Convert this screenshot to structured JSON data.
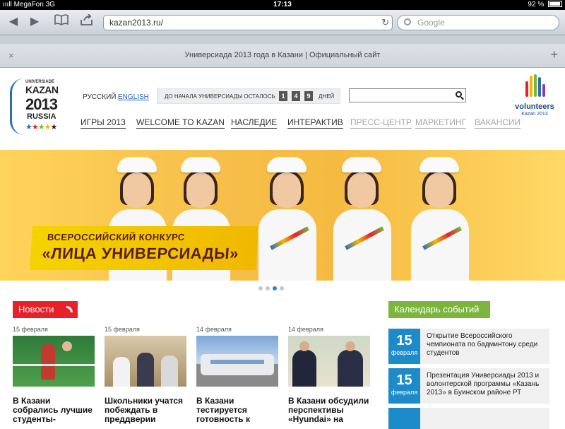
{
  "status_bar": {
    "carrier": "MegaFon",
    "network": "3G",
    "time": "17:13",
    "battery": "92 %"
  },
  "browser": {
    "url": "kazan2013.ru/",
    "search_placeholder": "Google",
    "tab_title": "Универсиада 2013 года в Казани | Официальный сайт",
    "close_tab": "×",
    "new_tab": "+"
  },
  "site": {
    "logo": {
      "universiade": "UNIVERSIADE",
      "city": "KAZAN",
      "year": "2013",
      "country": "RUSSIA",
      "stars": "★★★★★"
    },
    "lang": {
      "ru": "РУССКИЙ",
      "en": "ENGLISH"
    },
    "countdown": {
      "label": "ДО НАЧАЛА УНИВЕРСИАДЫ ОСТАЛОСЬ",
      "digits": [
        "1",
        "4",
        "9"
      ],
      "unit": "ДНЕЙ"
    },
    "volunteers": {
      "title": "volunteers",
      "subtitle": "Kazan 2013"
    },
    "nav": [
      {
        "label": "ИГРЫ 2013",
        "active": true
      },
      {
        "label": "WELCOME TO KAZAN",
        "active": true
      },
      {
        "label": "НАСЛЕДИЕ",
        "active": true
      },
      {
        "label": "ИНТЕРАКТИВ",
        "active": true
      },
      {
        "label": "ПРЕСС-ЦЕНТР",
        "active": false
      },
      {
        "label": "МАРКЕТИНГ",
        "active": false
      },
      {
        "label": "ВАКАНСИИ",
        "active": false
      }
    ],
    "banner": {
      "line1": "ВСЕРОССИЙСКИЙ КОНКУРС",
      "line2": "«ЛИЦА УНИВЕРСИАДЫ»"
    },
    "slider": {
      "count": 4,
      "active": 3
    },
    "news": {
      "heading": "Новости",
      "items": [
        {
          "date": "15 февраля",
          "title": "В Казани собрались лучшие студенты-"
        },
        {
          "date": "15 февраля",
          "title": "Школьники учатся побеждать в преддверии"
        },
        {
          "date": "14 февраля",
          "title": "В Казани тестируется готовность к"
        },
        {
          "date": "14 февраля",
          "title": "В Казани обсудили перспективы «Hyundai» на"
        }
      ]
    },
    "calendar": {
      "heading": "Календарь событий",
      "events": [
        {
          "day": "15",
          "month": "февраля",
          "text": "Открытие Всероссийского чемпионата по бадминтону среди студентов"
        },
        {
          "day": "15",
          "month": "февраля",
          "text": "Презентация Универсиады 2013 и волонтерской программы «Казань 2013» в Буинском районе РТ"
        }
      ]
    }
  }
}
